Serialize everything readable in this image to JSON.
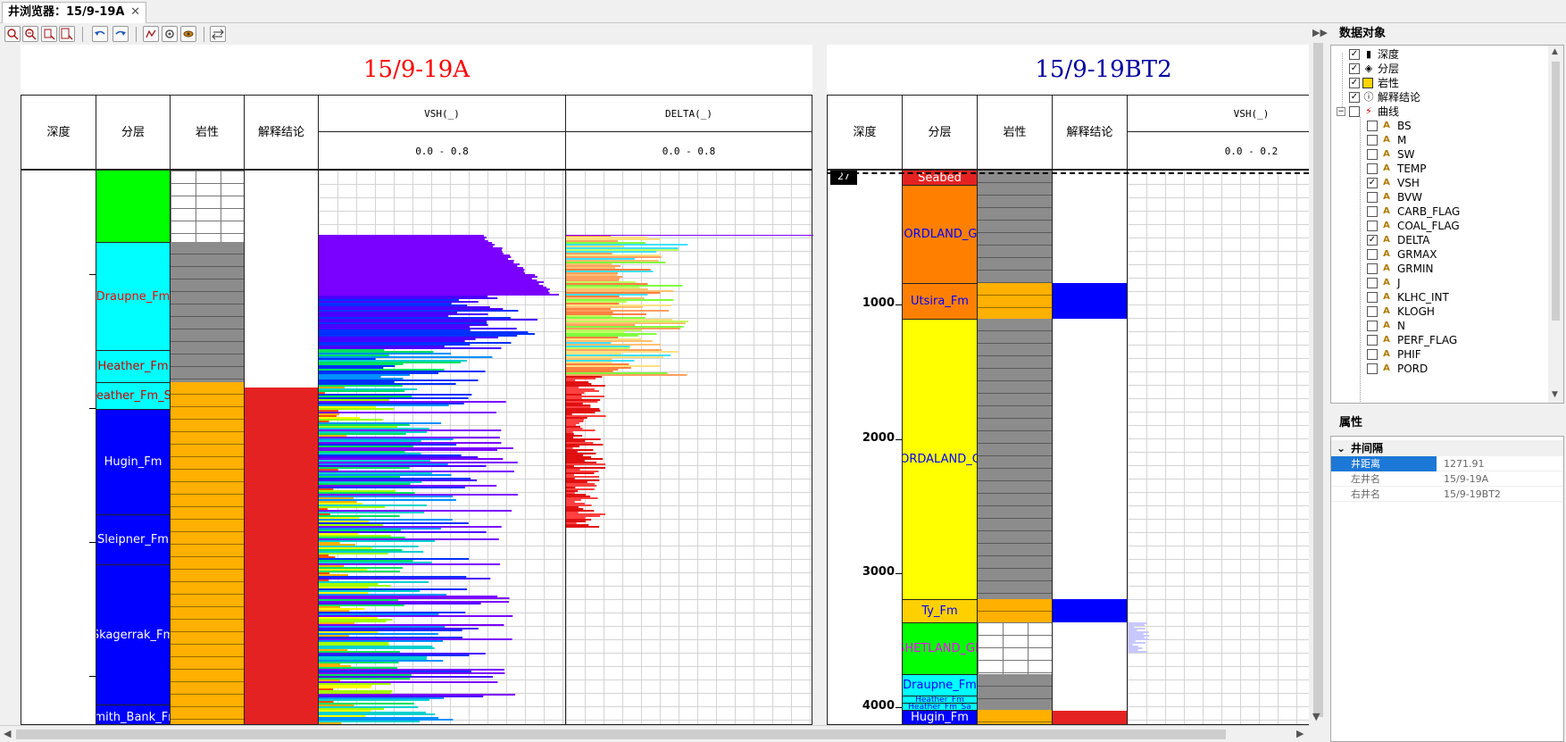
{
  "window": {
    "tab_title": "井浏览器：15/9-19A",
    "close_glyph": "✕"
  },
  "toolbar": {
    "buttons": [
      "zoom-in",
      "zoom-out",
      "zoom-window",
      "zoom-fit",
      "undo",
      "redo",
      "add-curve",
      "settings",
      "export",
      "swap"
    ]
  },
  "wells": [
    {
      "name": "15/9-19A",
      "title_color": "#ff0000",
      "headers": {
        "depth": "深度",
        "layer": "分层",
        "litho": "岩性",
        "interp": "解释结论",
        "curve1_name": "VSH(_)",
        "curve1_range": "0.0  -  0.8",
        "curve2_name": "DELTA(_)",
        "curve2_range": "0.0  -  0.8"
      },
      "layers": [
        {
          "name": "",
          "color": "#00ff00",
          "text_color": "#000000"
        },
        {
          "name": "Draupne_Fm",
          "color": "#00ffff",
          "text_color": "#ff0000"
        },
        {
          "name": "Heather_Fm",
          "color": "#00ffff",
          "text_color": "#cc0000"
        },
        {
          "name": "Heather_Fm_Sa",
          "color": "#00ffff",
          "text_color": "#cc0000"
        },
        {
          "name": "Hugin_Fm",
          "color": "#0000ff",
          "text_color": "#ffffff"
        },
        {
          "name": "Sleipner_Fm",
          "color": "#0000ff",
          "text_color": "#ffffff"
        },
        {
          "name": "Skagerrak_Fm",
          "color": "#0000ff",
          "text_color": "#ffffff"
        },
        {
          "name": "Smith_Bank_Fm",
          "color": "#0000ff",
          "text_color": "#ffffff"
        }
      ],
      "interp_color": "#e52222"
    },
    {
      "name": "15/9-19BT2",
      "title_color": "#0000a0",
      "headers": {
        "depth": "深度",
        "layer": "分层",
        "litho": "岩性",
        "interp": "解释结论",
        "curve1_name": "VSH(_)",
        "curve1_range": "0.0  -  0.2"
      },
      "depth_marker": "27",
      "depth_labels": [
        "1000",
        "2000",
        "3000",
        "4000"
      ],
      "layers": [
        {
          "name": "Seabed",
          "color": "#e52222",
          "text_color": "#ffffff"
        },
        {
          "name": "NORDLAND_GP",
          "color": "#ff8000",
          "text_color": "#0000ff"
        },
        {
          "name": "Utsira_Fm",
          "color": "#ff8000",
          "text_color": "#0000ff"
        },
        {
          "name": "NORDALAND_GP",
          "color": "#ffff00",
          "text_color": "#0000ff"
        },
        {
          "name": "Ty_Fm",
          "color": "#ffd000",
          "text_color": "#0000ff"
        },
        {
          "name": "SHETLAND_GP",
          "color": "#00ff00",
          "text_color": "#ff00ff"
        },
        {
          "name": "Draupne_Fm",
          "color": "#00ffff",
          "text_color": "#0000ff"
        },
        {
          "name": "Heather_Fm",
          "color": "#00ffff",
          "text_color": "#0000ff"
        },
        {
          "name": "Heather_Fm_Sa",
          "color": "#00ffff",
          "text_color": "#0000ff"
        },
        {
          "name": "Hugin_Fm",
          "color": "#0000ff",
          "text_color": "#ffffff"
        }
      ]
    }
  ],
  "data_panel": {
    "title": "数据对象",
    "nodes": [
      {
        "label": "深度",
        "checked": true,
        "icon": "ruler-icon"
      },
      {
        "label": "分层",
        "checked": true,
        "icon": "layers-icon"
      },
      {
        "label": "岩性",
        "checked": true,
        "icon": "lithology-icon"
      },
      {
        "label": "解释结论",
        "checked": true,
        "icon": "info-icon"
      },
      {
        "label": "曲线",
        "checked": false,
        "icon": "curve-icon"
      }
    ],
    "curves": [
      {
        "label": "BS",
        "checked": false
      },
      {
        "label": "M",
        "checked": false
      },
      {
        "label": "SW",
        "checked": false
      },
      {
        "label": "TEMP",
        "checked": false
      },
      {
        "label": "VSH",
        "checked": true
      },
      {
        "label": "BVW",
        "checked": false
      },
      {
        "label": "CARB_FLAG",
        "checked": false
      },
      {
        "label": "COAL_FLAG",
        "checked": false
      },
      {
        "label": "DELTA",
        "checked": true
      },
      {
        "label": "GRMAX",
        "checked": false
      },
      {
        "label": "GRMIN",
        "checked": false
      },
      {
        "label": "J",
        "checked": false
      },
      {
        "label": "KLHC_INT",
        "checked": false
      },
      {
        "label": "KLOGH",
        "checked": false
      },
      {
        "label": "N",
        "checked": false
      },
      {
        "label": "PERF_FLAG",
        "checked": false
      },
      {
        "label": "PHIF",
        "checked": false
      },
      {
        "label": "PORD",
        "checked": false
      }
    ]
  },
  "properties": {
    "title": "属性",
    "group": "井间隔",
    "rows": [
      {
        "key": "井距离",
        "value": "1271.91",
        "selected": true
      },
      {
        "key": "左井名",
        "value": "15/9-19A",
        "selected": false
      },
      {
        "key": "右井名",
        "value": "15/9-19BT2",
        "selected": false
      }
    ]
  }
}
